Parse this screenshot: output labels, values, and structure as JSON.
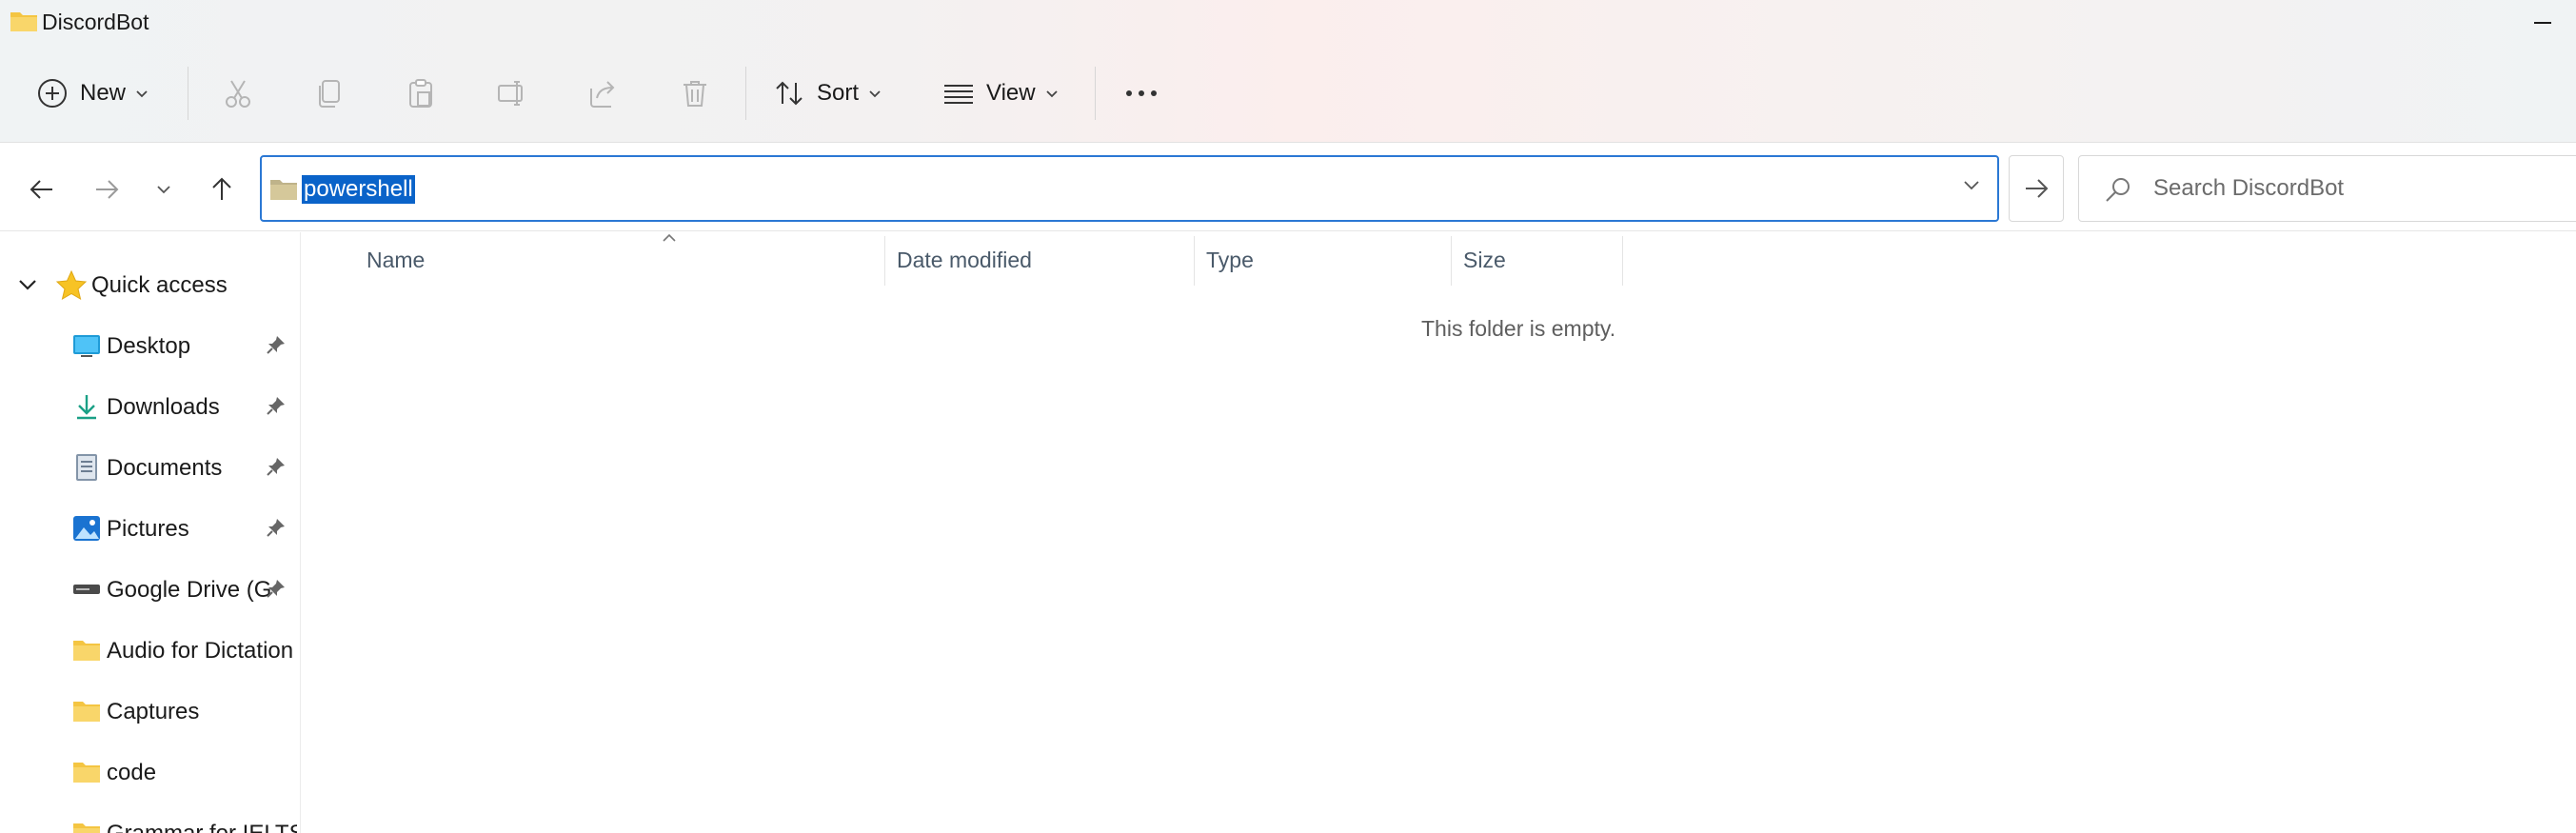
{
  "window": {
    "title": "DiscordBot",
    "minimize_label": ""
  },
  "toolbar": {
    "new_label": "New",
    "sort_label": "Sort",
    "view_label": "View",
    "icons": [
      "add-circle-icon",
      "cut-icon",
      "copy-icon",
      "paste-icon",
      "rename-icon",
      "share-icon",
      "delete-icon",
      "sort-icon",
      "view-icon",
      "more-icon"
    ]
  },
  "address_bar": {
    "path": "powershell",
    "search_placeholder": "Search DiscordBot"
  },
  "navigation": {
    "quick_access_label": "Quick access",
    "items": [
      {
        "label": "Desktop",
        "icon": "desktop-icon",
        "pinned": true
      },
      {
        "label": "Downloads",
        "icon": "download-icon",
        "pinned": true
      },
      {
        "label": "Documents",
        "icon": "documents-icon",
        "pinned": true
      },
      {
        "label": "Pictures",
        "icon": "pictures-icon",
        "pinned": true
      },
      {
        "label": "Google Drive (G",
        "icon": "drive-icon",
        "pinned": true
      },
      {
        "label": "Audio for Dictation",
        "icon": "folder-icon",
        "pinned": false
      },
      {
        "label": "Captures",
        "icon": "folder-icon",
        "pinned": false
      },
      {
        "label": "code",
        "icon": "folder-icon",
        "pinned": false
      },
      {
        "label": "Grammar for IELTS",
        "icon": "folder-icon",
        "pinned": false
      }
    ]
  },
  "columns": {
    "name": "Name",
    "date_modified": "Date modified",
    "type": "Type",
    "size": "Size"
  },
  "content": {
    "empty_message": "This folder is empty."
  },
  "colors": {
    "accent": "#2b78d4",
    "selection": "#0a63c9",
    "folder": "#f4c542"
  }
}
